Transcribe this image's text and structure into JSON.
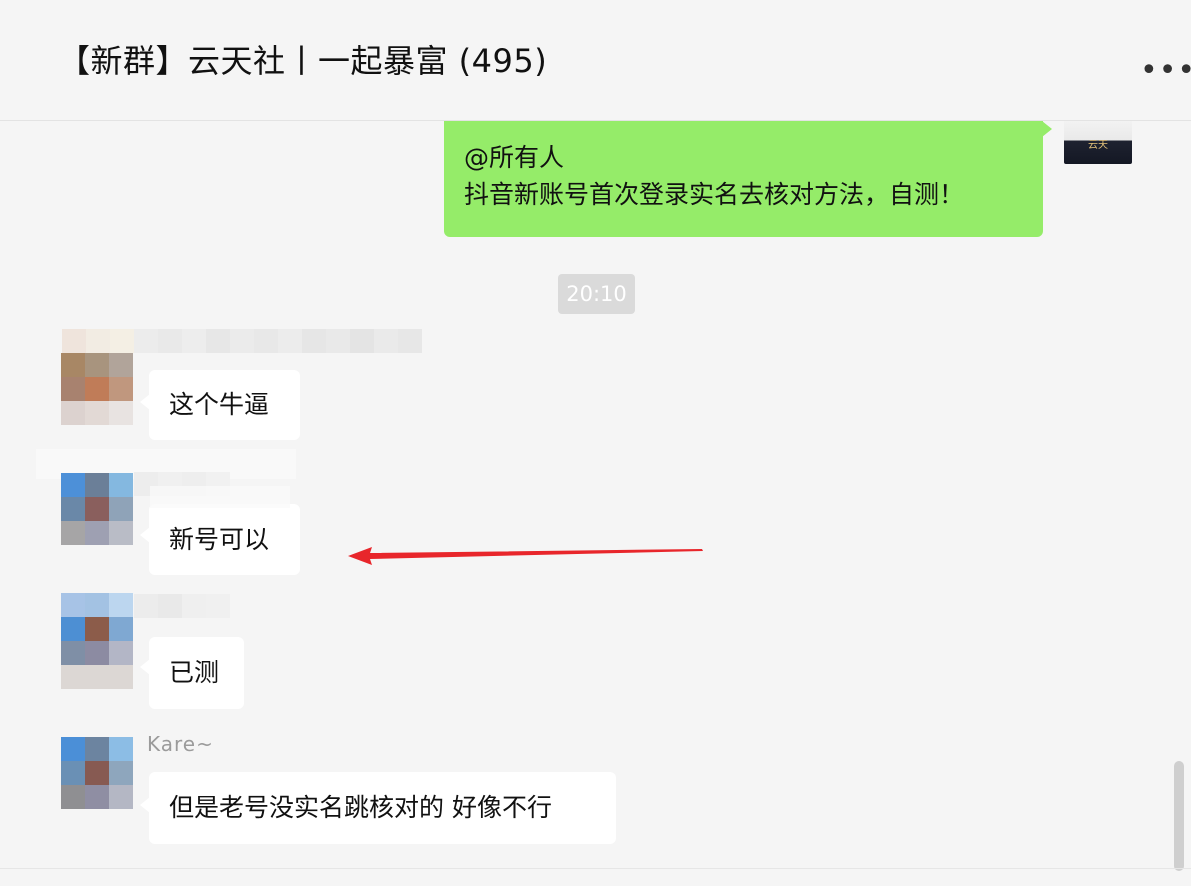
{
  "header": {
    "title": "【新群】云天社丨一起暴富 (495)",
    "more_icon": "more-icon",
    "more_glyph": "•••"
  },
  "messages": [
    {
      "sender": "self",
      "lines": [
        "@所有人",
        "抖音新账号首次登录实名去核对方法，自测！"
      ]
    },
    {
      "type": "time",
      "text": "20:10"
    },
    {
      "sender": "blurred-1",
      "text": "这个牛逼"
    },
    {
      "sender": "blurred-2",
      "text": "新号可以"
    },
    {
      "sender": "blurred-3",
      "text": "已测"
    },
    {
      "sender": "Kare~",
      "name": "Kare~",
      "text": "但是老号没实名跳核对的 好像不行"
    }
  ],
  "self_avatar": {
    "logo_text": "云天"
  },
  "annotation": {
    "arrow_color": "#e8262b"
  },
  "colors": {
    "outgoing_bubble": "#95ec69",
    "incoming_bubble": "#ffffff",
    "background": "#f5f5f5"
  }
}
